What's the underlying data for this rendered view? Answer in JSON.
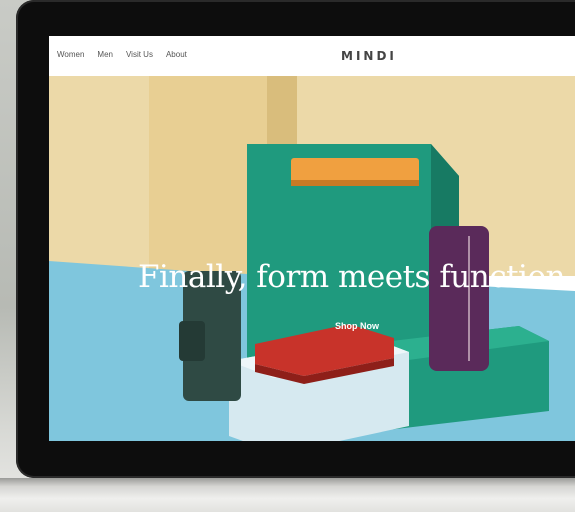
{
  "nav": {
    "links": [
      "Women",
      "Men",
      "Visit Us",
      "About"
    ],
    "brand": "MINDI"
  },
  "hero": {
    "headline": "Finally, form meets function",
    "cta_label": "Shop Now"
  },
  "colors": {
    "wall": "#ecd9a8",
    "floor": "#7fc6dd",
    "teal_block": "#1f9a7e",
    "white_block": "#d6e9f0",
    "wallet_orange": "#f0a040",
    "wallet_red": "#c8332a",
    "wallet_purple": "#5a2a5a",
    "wallet_green": "#2f4a44"
  }
}
